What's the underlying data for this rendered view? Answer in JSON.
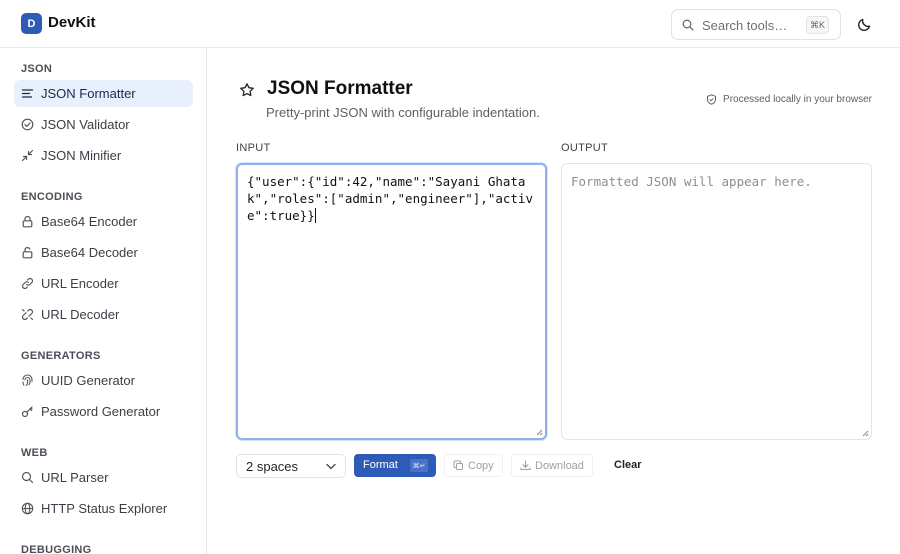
{
  "app": {
    "logo_letter": "D",
    "name": "DevKit"
  },
  "header": {
    "search_placeholder": "Search tools…",
    "search_shortcut": "⌘K",
    "theme_icon": "moon-icon"
  },
  "sidebar": {
    "groups": [
      {
        "label": "JSON",
        "items": [
          {
            "label": "JSON Formatter",
            "icon": "align-left-icon",
            "active": true
          },
          {
            "label": "JSON Validator",
            "icon": "check-circle-icon"
          },
          {
            "label": "JSON Minifier",
            "icon": "minimize-icon"
          }
        ]
      },
      {
        "label": "ENCODING",
        "items": [
          {
            "label": "Base64 Encoder",
            "icon": "lock-icon"
          },
          {
            "label": "Base64 Decoder",
            "icon": "unlock-icon"
          },
          {
            "label": "URL Encoder",
            "icon": "link-icon"
          },
          {
            "label": "URL Decoder",
            "icon": "unlink-icon"
          }
        ]
      },
      {
        "label": "GENERATORS",
        "items": [
          {
            "label": "UUID Generator",
            "icon": "fingerprint-icon"
          },
          {
            "label": "Password Generator",
            "icon": "key-icon"
          }
        ]
      },
      {
        "label": "WEB",
        "items": [
          {
            "label": "URL Parser",
            "icon": "search-icon"
          },
          {
            "label": "HTTP Status Explorer",
            "icon": "globe-icon"
          }
        ]
      },
      {
        "label": "DEBUGGING",
        "items": []
      }
    ]
  },
  "main": {
    "title": "JSON Formatter",
    "subtitle": "Pretty-print JSON with configurable indentation.",
    "privacy_note": "Processed locally in your browser",
    "input_label": "INPUT",
    "output_label": "OUTPUT",
    "input_value": "{\"user\":{\"id\":42,\"name\":\"Sayani Ghatak\",\"roles\":[\"admin\",\"engineer\"],\"active\":true}}",
    "output_placeholder": "Formatted JSON will appear here.",
    "indent_value": "2 spaces",
    "format_label": "Format",
    "format_shortcut": "⌘↵",
    "copy_label": "Copy",
    "download_label": "Download",
    "clear_label": "Clear"
  },
  "colors": {
    "accent": "#2f5bb8",
    "active_bg": "#e8effd"
  }
}
